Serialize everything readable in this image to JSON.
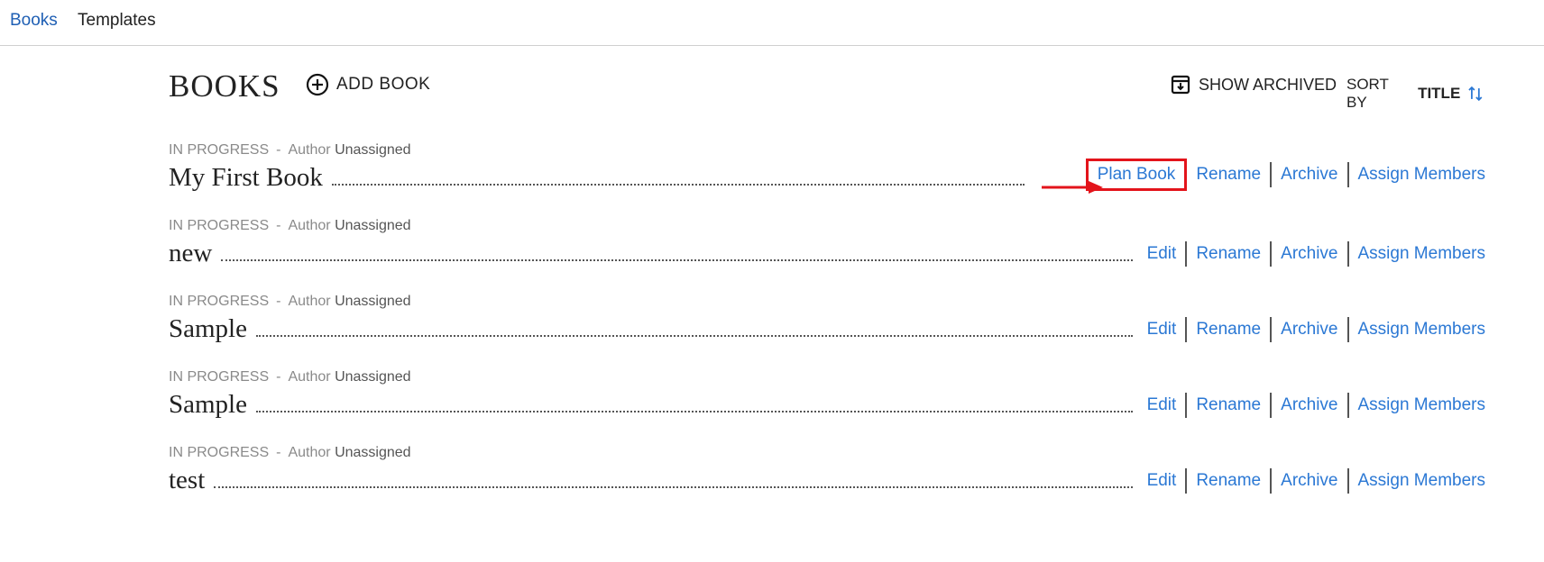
{
  "nav": {
    "items": [
      {
        "label": "Books",
        "active": true
      },
      {
        "label": "Templates",
        "active": false
      }
    ]
  },
  "header": {
    "title": "BOOKS",
    "add_book_label": "ADD BOOK",
    "show_archived_label": "SHOW ARCHIVED",
    "sort_prefix": "SORT BY",
    "sort_field": "TITLE"
  },
  "books": [
    {
      "status": "IN PROGRESS",
      "author_label": "Author",
      "author_value": "Unassigned",
      "title": "My First Book",
      "actions": [
        "Plan Book",
        "Rename",
        "Archive",
        "Assign Members"
      ]
    },
    {
      "status": "IN PROGRESS",
      "author_label": "Author",
      "author_value": "Unassigned",
      "title": "new",
      "actions": [
        "Edit",
        "Rename",
        "Archive",
        "Assign Members"
      ]
    },
    {
      "status": "IN PROGRESS",
      "author_label": "Author",
      "author_value": "Unassigned",
      "title": "Sample",
      "actions": [
        "Edit",
        "Rename",
        "Archive",
        "Assign Members"
      ]
    },
    {
      "status": "IN PROGRESS",
      "author_label": "Author",
      "author_value": "Unassigned",
      "title": "Sample",
      "actions": [
        "Edit",
        "Rename",
        "Archive",
        "Assign Members"
      ]
    },
    {
      "status": "IN PROGRESS",
      "author_label": "Author",
      "author_value": "Unassigned",
      "title": "test",
      "actions": [
        "Edit",
        "Rename",
        "Archive",
        "Assign Members"
      ]
    }
  ],
  "colors": {
    "link": "#2b78d4",
    "nav_active": "#1f5fb4",
    "highlight": "#e3141b"
  },
  "icons": {
    "add_book": "plus-circle-icon",
    "show_archived": "archive-box-icon",
    "sort": "sort-arrows-icon"
  }
}
